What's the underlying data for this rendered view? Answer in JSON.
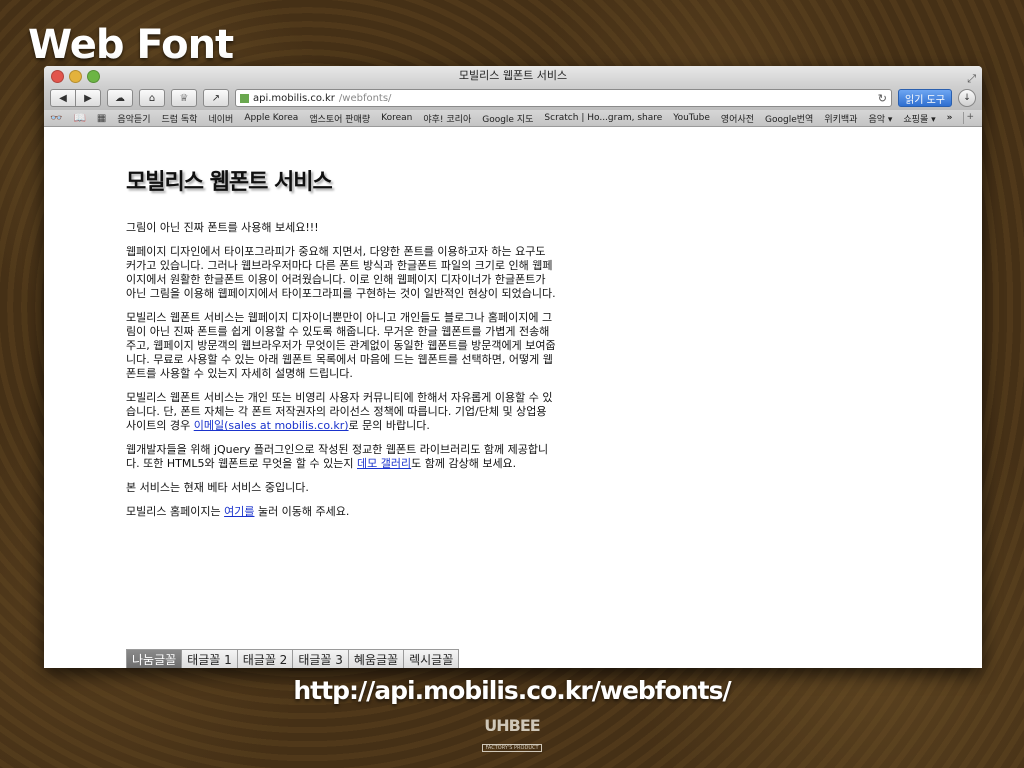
{
  "slide": {
    "title": "Web Font",
    "caption": "http://api.mobilis.co.kr/webfonts/"
  },
  "window": {
    "title": "모빌리스 웹폰트 서비스"
  },
  "toolbar": {
    "url_host": "api.mobilis.co.kr",
    "url_path": "/webfonts/",
    "reader_label": "읽기 도구"
  },
  "bookmarks": [
    "음악듣기",
    "드럼 독학",
    "네이버",
    "Apple Korea",
    "앱스토어 판매량",
    "Korean",
    "야후! 코리아",
    "Google 지도",
    "Scratch | Ho...gram, share",
    "YouTube",
    "영어사전",
    "Google번역",
    "위키백과",
    "음악 ▾",
    "쇼핑몰 ▾"
  ],
  "page": {
    "heading": "모빌리스 웹폰트 서비스",
    "p1": "그림이 아닌 진짜 폰트를 사용해 보세요!!!",
    "p2": "웹페이지 디자인에서 타이포그라피가 중요해 지면서, 다양한 폰트를 이용하고자 하는 요구도 커가고 있습니다. 그러나 웹브라우저마다 다른 폰트 방식과 한글폰트 파일의 크기로 인해 웹페이지에서 원활한 한글폰트 이용이 어려웠습니다. 이로 인해 웹페이지 디자이너가 한글폰트가 아닌 그림을 이용해 웹페이지에서 타이포그라피를 구현하는 것이 일반적인 현상이 되었습니다.",
    "p3": "모빌리스 웹폰트 서비스는 웹페이지 디자이너뿐만이 아니고 개인들도 블로그나 홈페이지에 그림이 아닌 진짜 폰트를 쉽게 이용할 수 있도록 해줍니다. 무거운 한글 웹폰트를 가볍게 전송해 주고, 웹페이지 방문객의 웹브라우저가 무엇이든 관계없이 동일한 웹폰트를 방문객에게 보여줍니다. 무료로 사용할 수 있는 아래 웹폰트 목록에서 마음에 드는 웹폰트를 선택하면, 어떻게 웹폰트를 사용할 수 있는지 자세히 설명해 드립니다.",
    "p4_before": "모빌리스 웹폰트 서비스는 개인 또는 비영리 사용자 커뮤니티에 한해서 자유롭게 이용할 수 있습니다. 단, 폰트 자체는 각 폰트 저작권자의 라이선스 정책에 따릅니다. 기업/단체 및 상업용 사이트의 경우 ",
    "p4_link": "이메일(sales at mobilis.co.kr)",
    "p4_after": "로 문의 바랍니다.",
    "p5_before": "웹개발자들을 위해 jQuery 플러그인으로 작성된 정교한 웹폰트 라이브러리도 함께 제공합니다. 또한 HTML5와 웹폰트로 무엇을 할 수 있는지 ",
    "p5_link": "데모 갤러리",
    "p5_after": "도 함께 감상해 보세요.",
    "p6": "본 서비스는 현재 베타 서비스 중입니다.",
    "p7_before": "모빌리스 홈페이지는 ",
    "p7_link": "여기를",
    "p7_after": " 눌러 이동해 주세요."
  },
  "tabs": [
    "나눔글꼴",
    "태글꼴 1",
    "태글꼴 2",
    "태글꼴 3",
    "혜움글꼴",
    "렉시글꼴"
  ],
  "logo": {
    "main": "UHBEE",
    "sub": "FACTORY'S PRODUCT"
  }
}
